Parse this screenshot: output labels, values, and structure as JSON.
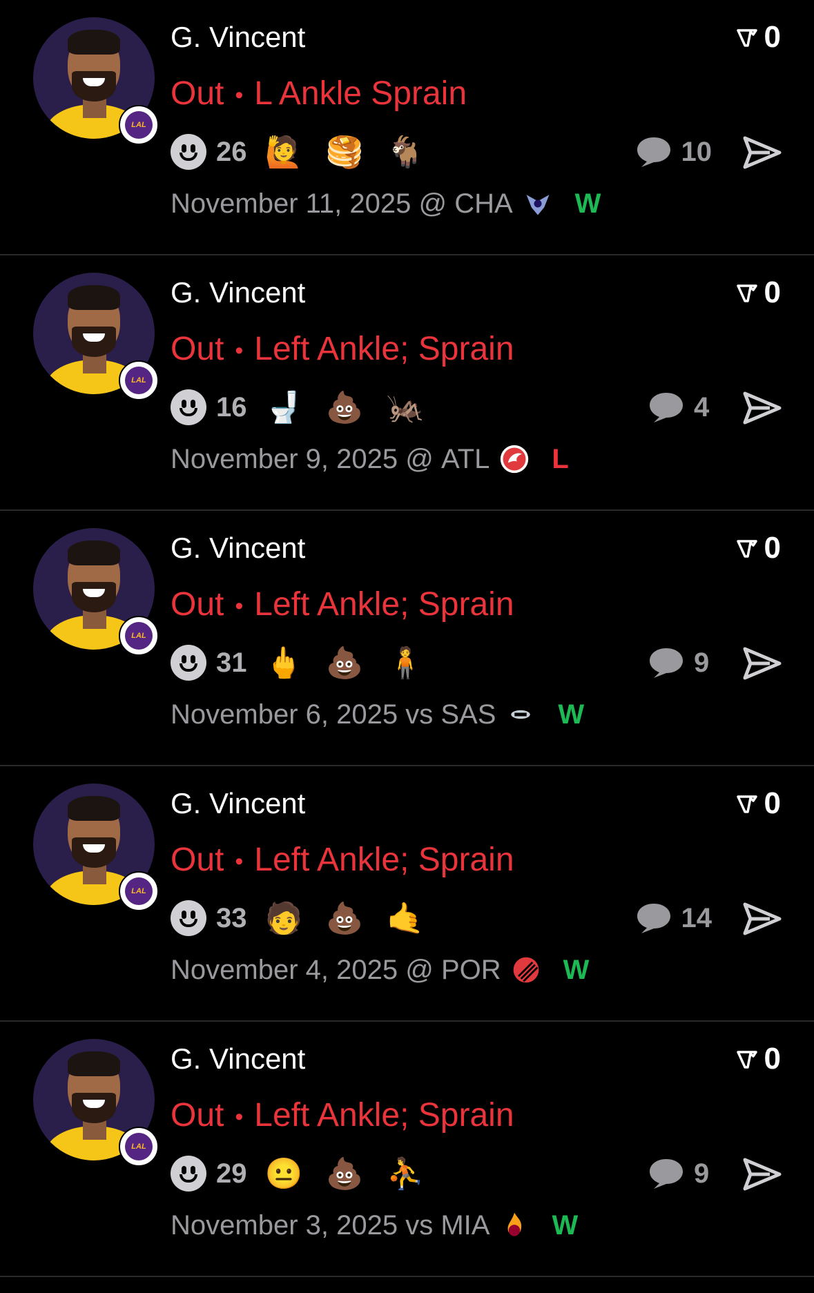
{
  "colors": {
    "status_red": "#e8343a",
    "win_green": "#1db954",
    "muted_gray": "#9a9a9e",
    "background": "#000000"
  },
  "posts": [
    {
      "player_name": "G. Vincent",
      "status": "Out",
      "injury": "L Ankle Sprain",
      "votes": "0",
      "reaction_count": "26",
      "reactions": [
        "🙋",
        "🥞",
        "🐐"
      ],
      "comment_count": "10",
      "date": "November 11, 2025",
      "venue": "@",
      "opponent": "CHA",
      "opponent_logo": "hornets-logo",
      "result": "W"
    },
    {
      "player_name": "G. Vincent",
      "status": "Out",
      "injury": "Left Ankle; Sprain",
      "votes": "0",
      "reaction_count": "16",
      "reactions": [
        "🚽",
        "💩",
        "🦗"
      ],
      "comment_count": "4",
      "date": "November 9, 2025",
      "venue": "@",
      "opponent": "ATL",
      "opponent_logo": "hawks-logo",
      "result": "L"
    },
    {
      "player_name": "G. Vincent",
      "status": "Out",
      "injury": "Left Ankle; Sprain",
      "votes": "0",
      "reaction_count": "31",
      "reactions": [
        "🖕",
        "💩",
        "🧍"
      ],
      "comment_count": "9",
      "date": "November 6, 2025",
      "venue": "vs",
      "opponent": "SAS",
      "opponent_logo": "spurs-logo",
      "result": "W"
    },
    {
      "player_name": "G. Vincent",
      "status": "Out",
      "injury": "Left Ankle; Sprain",
      "votes": "0",
      "reaction_count": "33",
      "reactions": [
        "🧑",
        "💩",
        "🤙"
      ],
      "comment_count": "14",
      "date": "November 4, 2025",
      "venue": "@",
      "opponent": "POR",
      "opponent_logo": "blazers-logo",
      "result": "W"
    },
    {
      "player_name": "G. Vincent",
      "status": "Out",
      "injury": "Left Ankle; Sprain",
      "votes": "0",
      "reaction_count": "29",
      "reactions": [
        "😐",
        "💩",
        "⛹"
      ],
      "comment_count": "9",
      "date": "November 3, 2025",
      "venue": "vs",
      "opponent": "MIA",
      "opponent_logo": "heat-logo",
      "result": "W"
    }
  ]
}
